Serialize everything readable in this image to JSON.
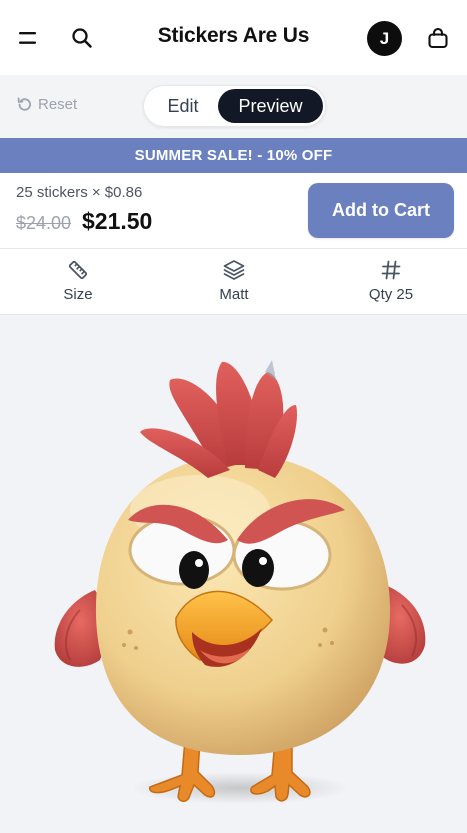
{
  "header": {
    "title": "Stickers Are Us",
    "avatar_initial": "J",
    "icons": {
      "menu": "menu-icon",
      "search": "search-icon",
      "cart": "shopping-bag-icon"
    }
  },
  "toolbar": {
    "reset_label": "Reset",
    "modes": [
      "Edit",
      "Preview"
    ],
    "active_mode": "Preview"
  },
  "banner": {
    "text": "SUMMER SALE! - 10% OFF"
  },
  "pricing": {
    "quantity_line": "25 stickers × $0.86",
    "original_price": "$24.00",
    "sale_price": "$21.50",
    "add_to_cart_label": "Add to Cart"
  },
  "options": [
    {
      "label": "Size",
      "icon": "ruler-icon"
    },
    {
      "label": "Matt",
      "icon": "layers-icon"
    },
    {
      "label": "Qty 25",
      "icon": "hash-icon"
    }
  ],
  "colors": {
    "accent": "#6b80bf",
    "dark": "#121826",
    "preview_bg": "#f2f3f6"
  },
  "preview": {
    "subject": "angry cartoon chicken sticker"
  }
}
